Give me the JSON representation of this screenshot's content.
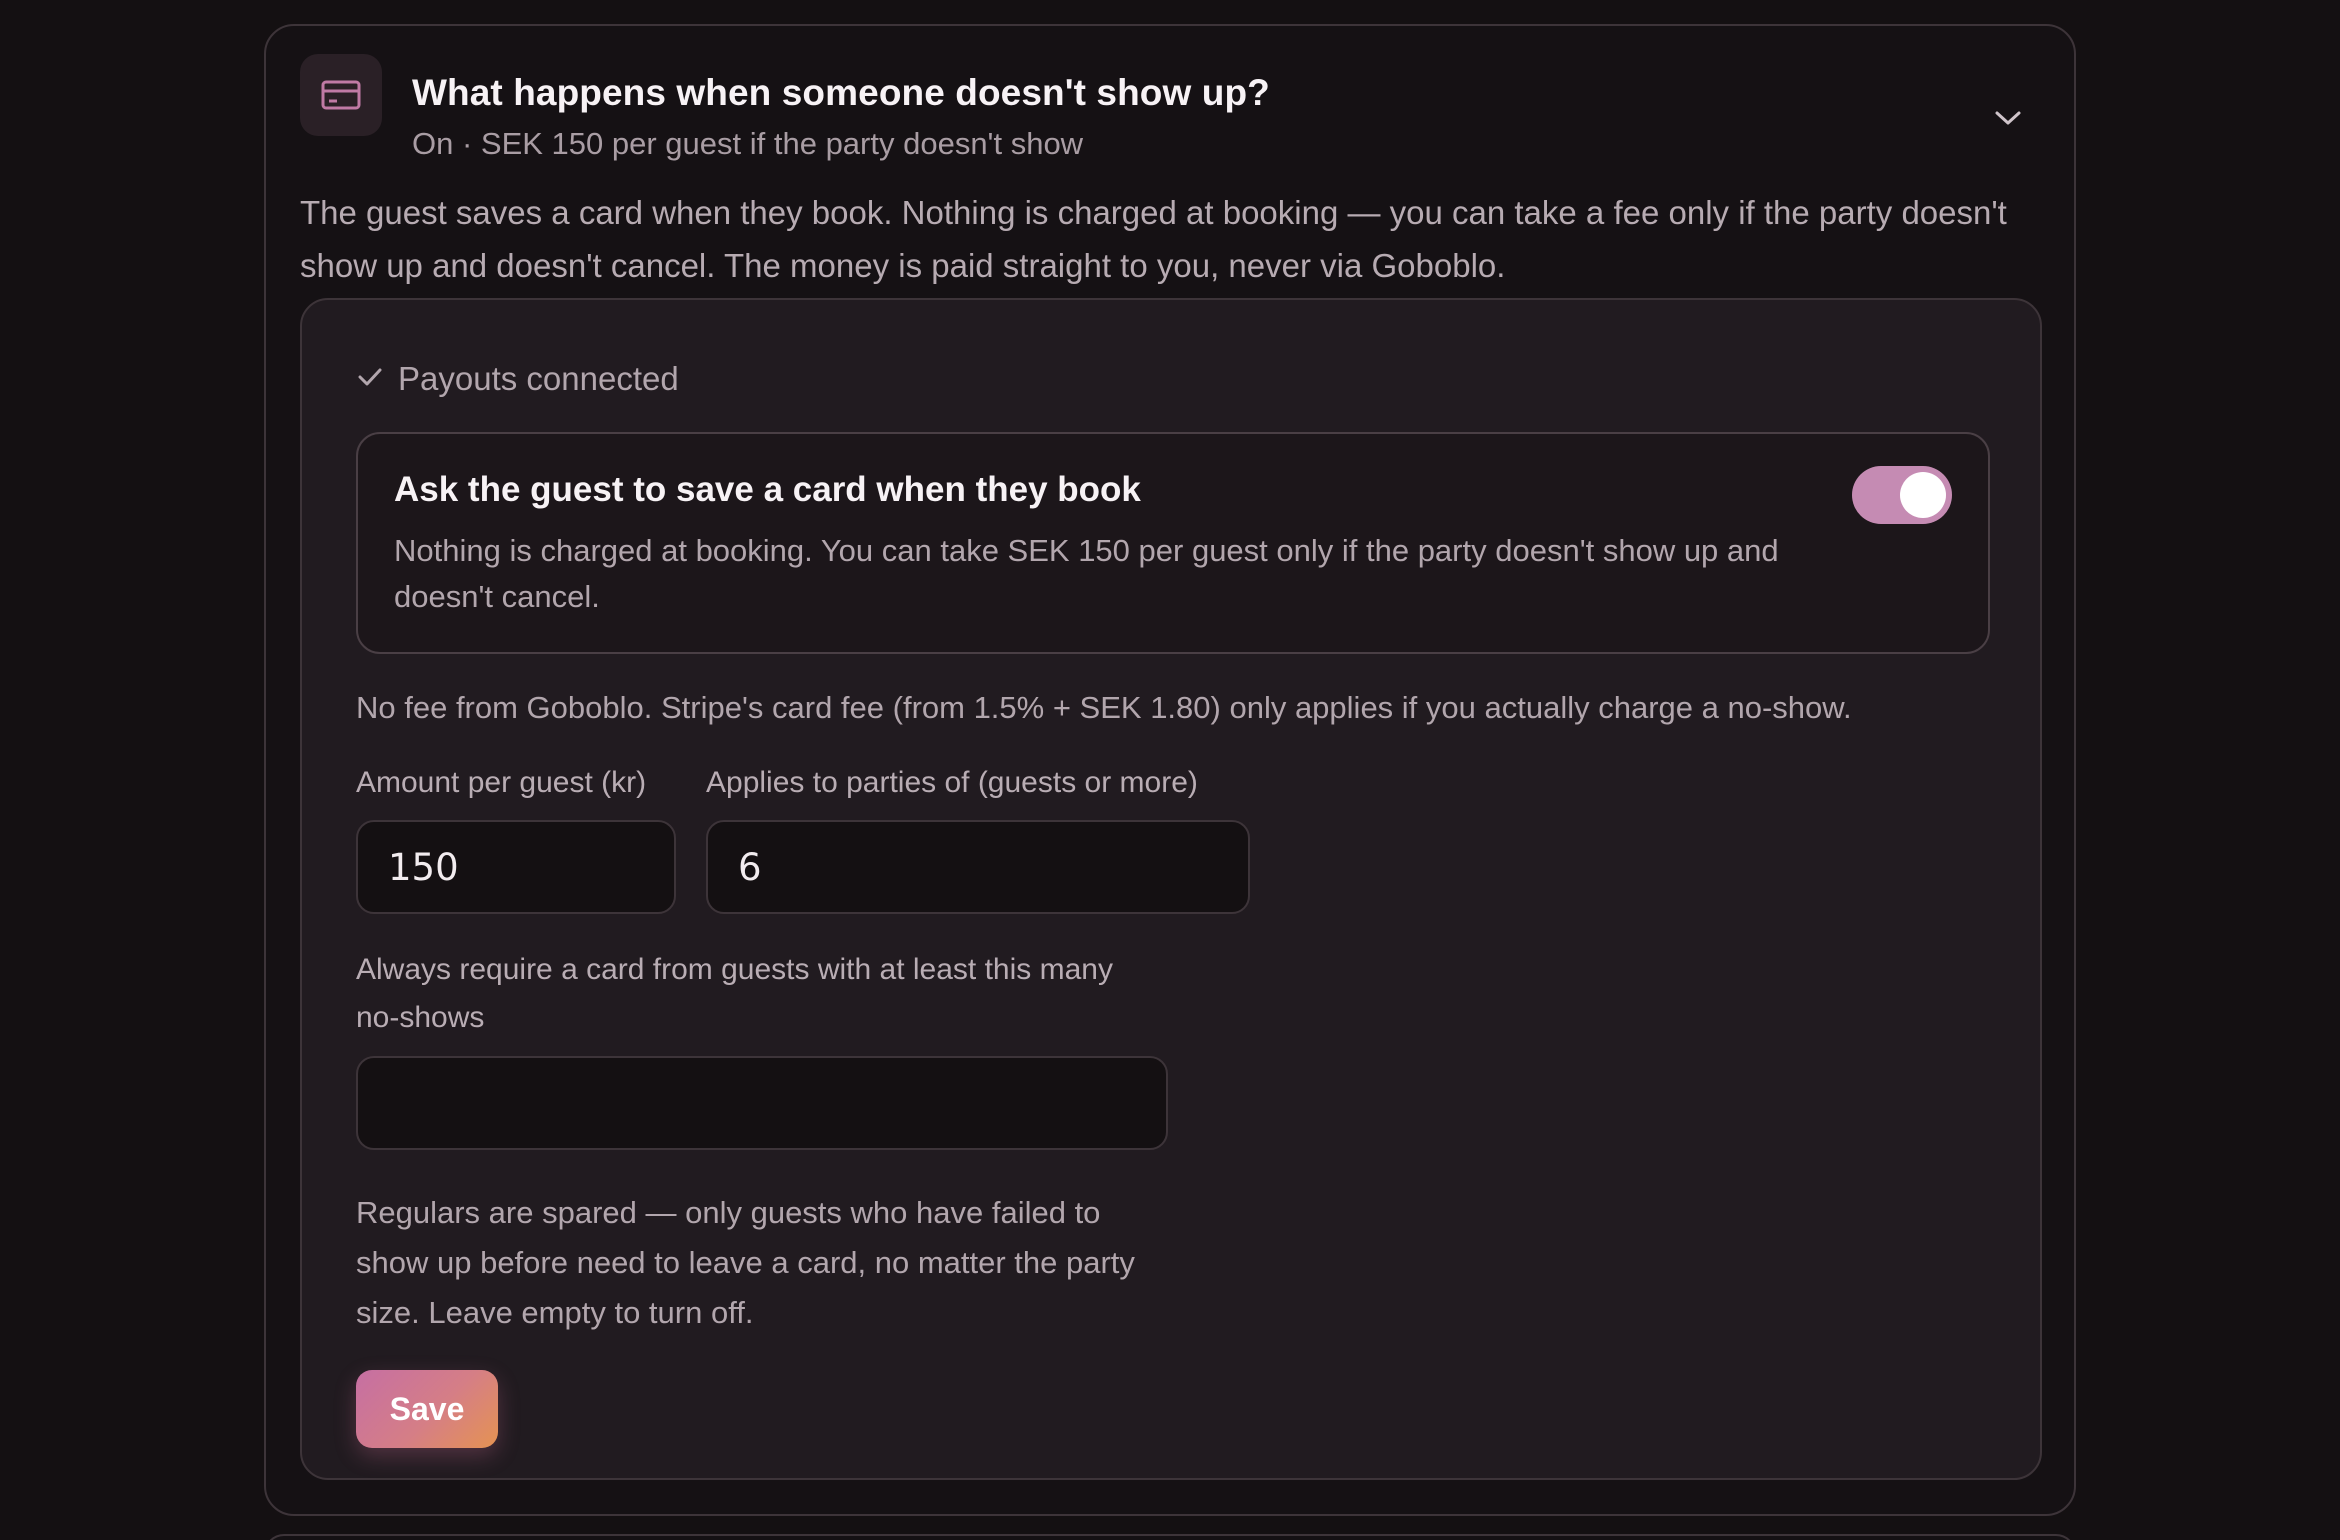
{
  "colors": {
    "background": "#141012",
    "panel": "#211b20",
    "accent_toggle": "#c58bb3",
    "save_gradient_start": "#c66fa3",
    "save_gradient_end": "#e59352",
    "icon_pink": "#c07aa5"
  },
  "section": {
    "icon": "credit-card-icon",
    "title": "What happens when someone doesn't show up?",
    "subtitle": "On · SEK 150 per guest if the party doesn't show",
    "expand_icon": "chevron-down-icon",
    "intro": "The guest saves a card when they book. Nothing is charged at booking — you can take a fee only if the party doesn't show up and doesn't cancel. The money is paid straight to you, never via Goboblo."
  },
  "payouts": {
    "icon": "check-icon",
    "label": "Payouts connected"
  },
  "card_option": {
    "title": "Ask the guest to save a card when they book",
    "description": "Nothing is charged at booking. You can take SEK 150 per guest only if the party doesn't show up and doesn't cancel.",
    "enabled": true
  },
  "fee_note": "No fee from Goboblo. Stripe's card fee (from 1.5% + SEK 1.80) only applies if you actually charge a no-show.",
  "fields": {
    "amount": {
      "label": "Amount per guest (kr)",
      "value": "150"
    },
    "parties": {
      "label": "Applies to parties of (guests or more)",
      "value": "6"
    },
    "noshows": {
      "label": "Always require a card from guests with at least this many no-shows",
      "value": ""
    }
  },
  "help_text": "Regulars are spared — only guests who have failed to show up before need to leave a card, no matter the party size. Leave empty to turn off.",
  "save_label": "Save"
}
